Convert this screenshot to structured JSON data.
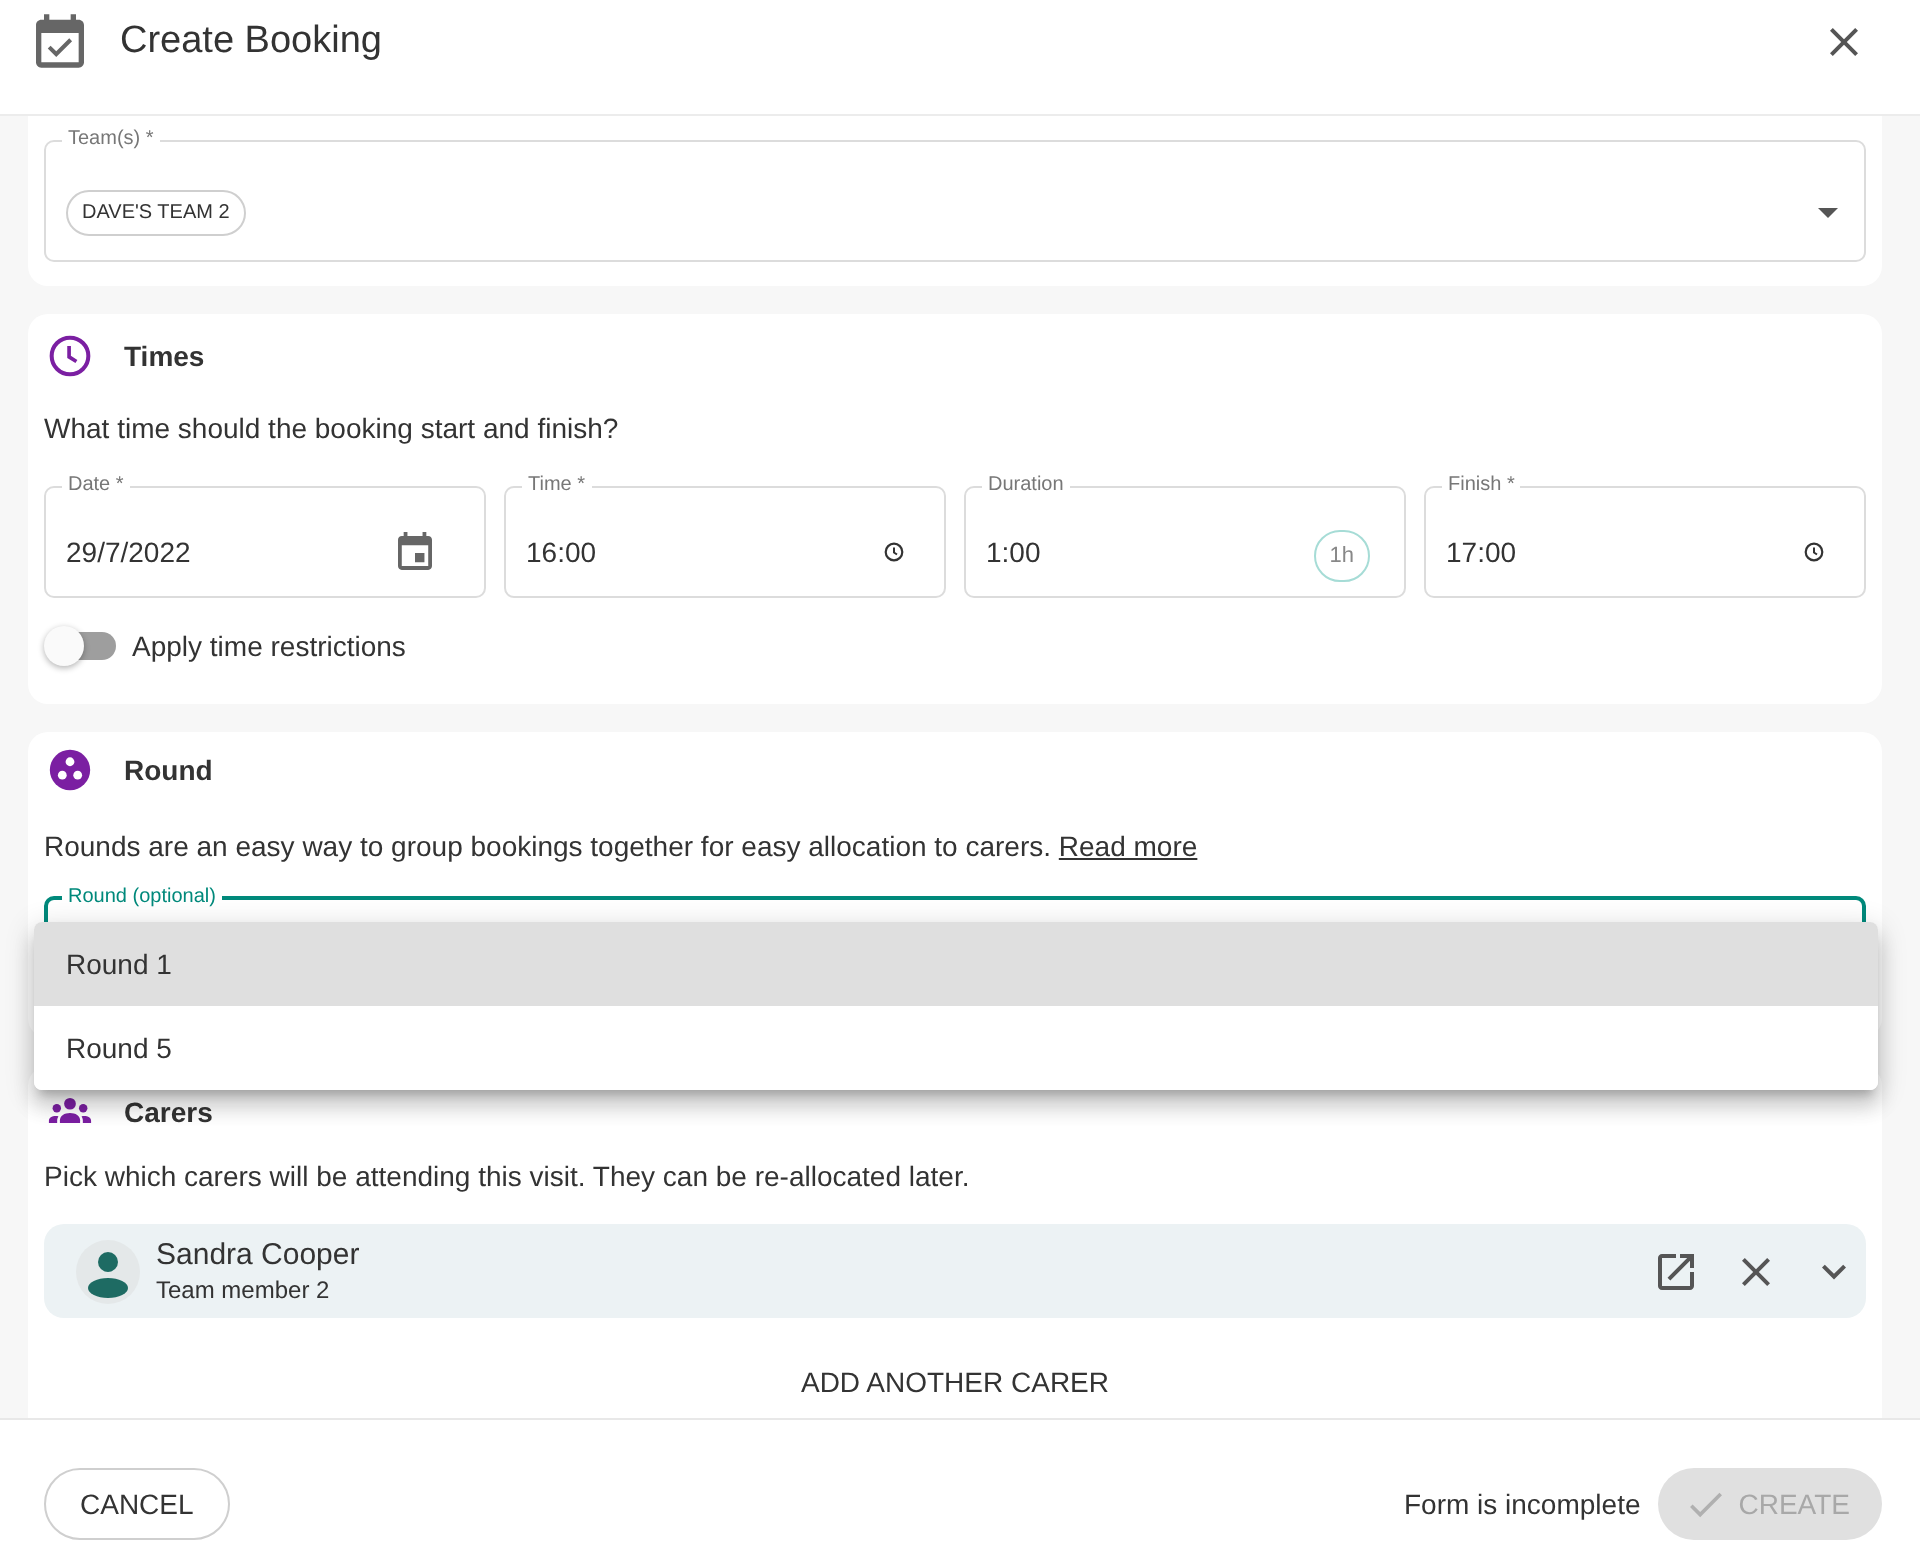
{
  "header": {
    "title": "Create Booking"
  },
  "team_section": {
    "field": {
      "label": "Team(s) *",
      "chips": [
        "DAVE'S TEAM 2"
      ]
    }
  },
  "times_section": {
    "title": "Times",
    "description": "What time should the booking start and finish?",
    "fields": [
      {
        "kind": "date",
        "label": "Date *",
        "value": "29/7/2022"
      },
      {
        "kind": "time",
        "label": "Time *",
        "value": "16:00"
      },
      {
        "kind": "duration",
        "label": "Duration",
        "value": "1:00",
        "chip": "1h"
      },
      {
        "kind": "time",
        "label": "Finish *",
        "value": "17:00"
      }
    ],
    "toggle": {
      "label": "Apply time restrictions",
      "on": false
    }
  },
  "round_section": {
    "title": "Round",
    "description": "Rounds are an easy way to group bookings together for easy allocation to carers.",
    "link": "Read more",
    "field": {
      "label": "Round (optional)",
      "focused": true,
      "expanded": true,
      "options": [
        {
          "label": "Round 1",
          "selected": true
        },
        {
          "label": "Round 5",
          "selected": false
        }
      ]
    }
  },
  "carers_section": {
    "title": "Carers",
    "description": "Pick which carers will be attending this visit. They can be re-allocated later.",
    "carers": [
      {
        "name": "Sandra Cooper",
        "role": "Team member 2"
      }
    ],
    "add_button": "ADD ANOTHER CARER"
  },
  "footer": {
    "cancel": "CANCEL",
    "status": "Form is incomplete",
    "create": {
      "label": "CREATE",
      "disabled": true
    }
  }
}
